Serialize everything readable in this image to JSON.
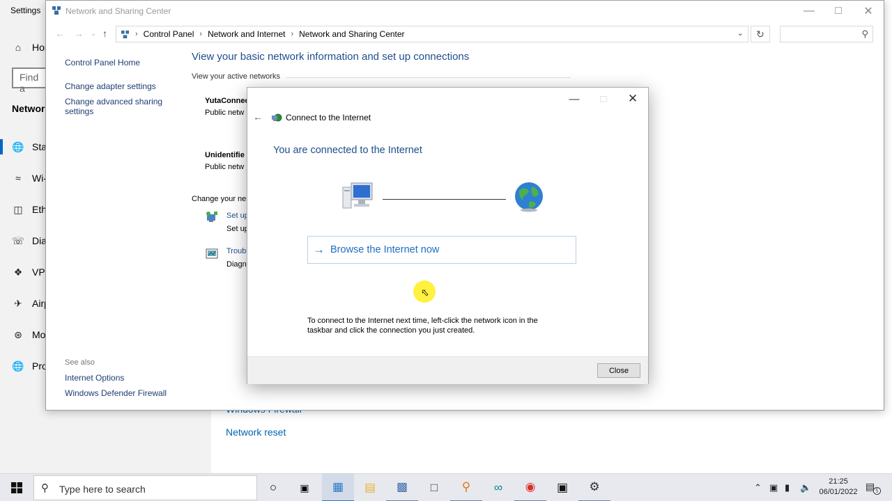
{
  "settings": {
    "title": "Settings",
    "find_placeholder": "Find a",
    "section": "Network",
    "nav": [
      {
        "label": "Hom",
        "icon": "home-icon"
      },
      {
        "label": "Sta",
        "icon": "globe-icon"
      },
      {
        "label": "Wi-",
        "icon": "wifi-icon"
      },
      {
        "label": "Eth",
        "icon": "ethernet-icon"
      },
      {
        "label": "Dia",
        "icon": "dialup-icon"
      },
      {
        "label": "VPN",
        "icon": "vpn-icon"
      },
      {
        "label": "Airp",
        "icon": "airplane-icon"
      },
      {
        "label": "Mo",
        "icon": "hotspot-icon"
      },
      {
        "label": "Pro",
        "icon": "proxy-icon"
      }
    ],
    "network_reset": "Network reset",
    "firewall_peek": "Windows Firewall"
  },
  "control_panel": {
    "window_title": "Network and Sharing Center",
    "breadcrumbs": [
      "Control Panel",
      "Network and Internet",
      "Network and Sharing Center"
    ],
    "left_links": [
      "Control Panel Home",
      "Change adapter settings",
      "Change advanced sharing",
      "settings"
    ],
    "see_also_label": "See also",
    "see_also_links": [
      "Internet Options",
      "Windows Defender Firewall"
    ],
    "heading": "View your basic network information and set up connections",
    "active_networks_label": "View your active networks",
    "networks": [
      {
        "name": "YutaConnec",
        "type": "Public netw"
      },
      {
        "name": "Unidentifie",
        "type": "Public netw"
      }
    ],
    "change_label": "Change your ne",
    "tasks": [
      {
        "link": "Set up",
        "desc": "Set up"
      },
      {
        "link": "Troub",
        "desc": "Diagn"
      }
    ]
  },
  "dialog": {
    "title": "Connect to the Internet",
    "heading": "You are connected to the Internet",
    "browse_label": "Browse the Internet now",
    "note": "To connect to the Internet next time, left-click the network icon in the taskbar and click the connection you just created.",
    "close_label": "Close"
  },
  "taskbar": {
    "search_placeholder": "Type here to search",
    "time": "21:25",
    "date": "06/01/2022",
    "notification_count": "5"
  }
}
